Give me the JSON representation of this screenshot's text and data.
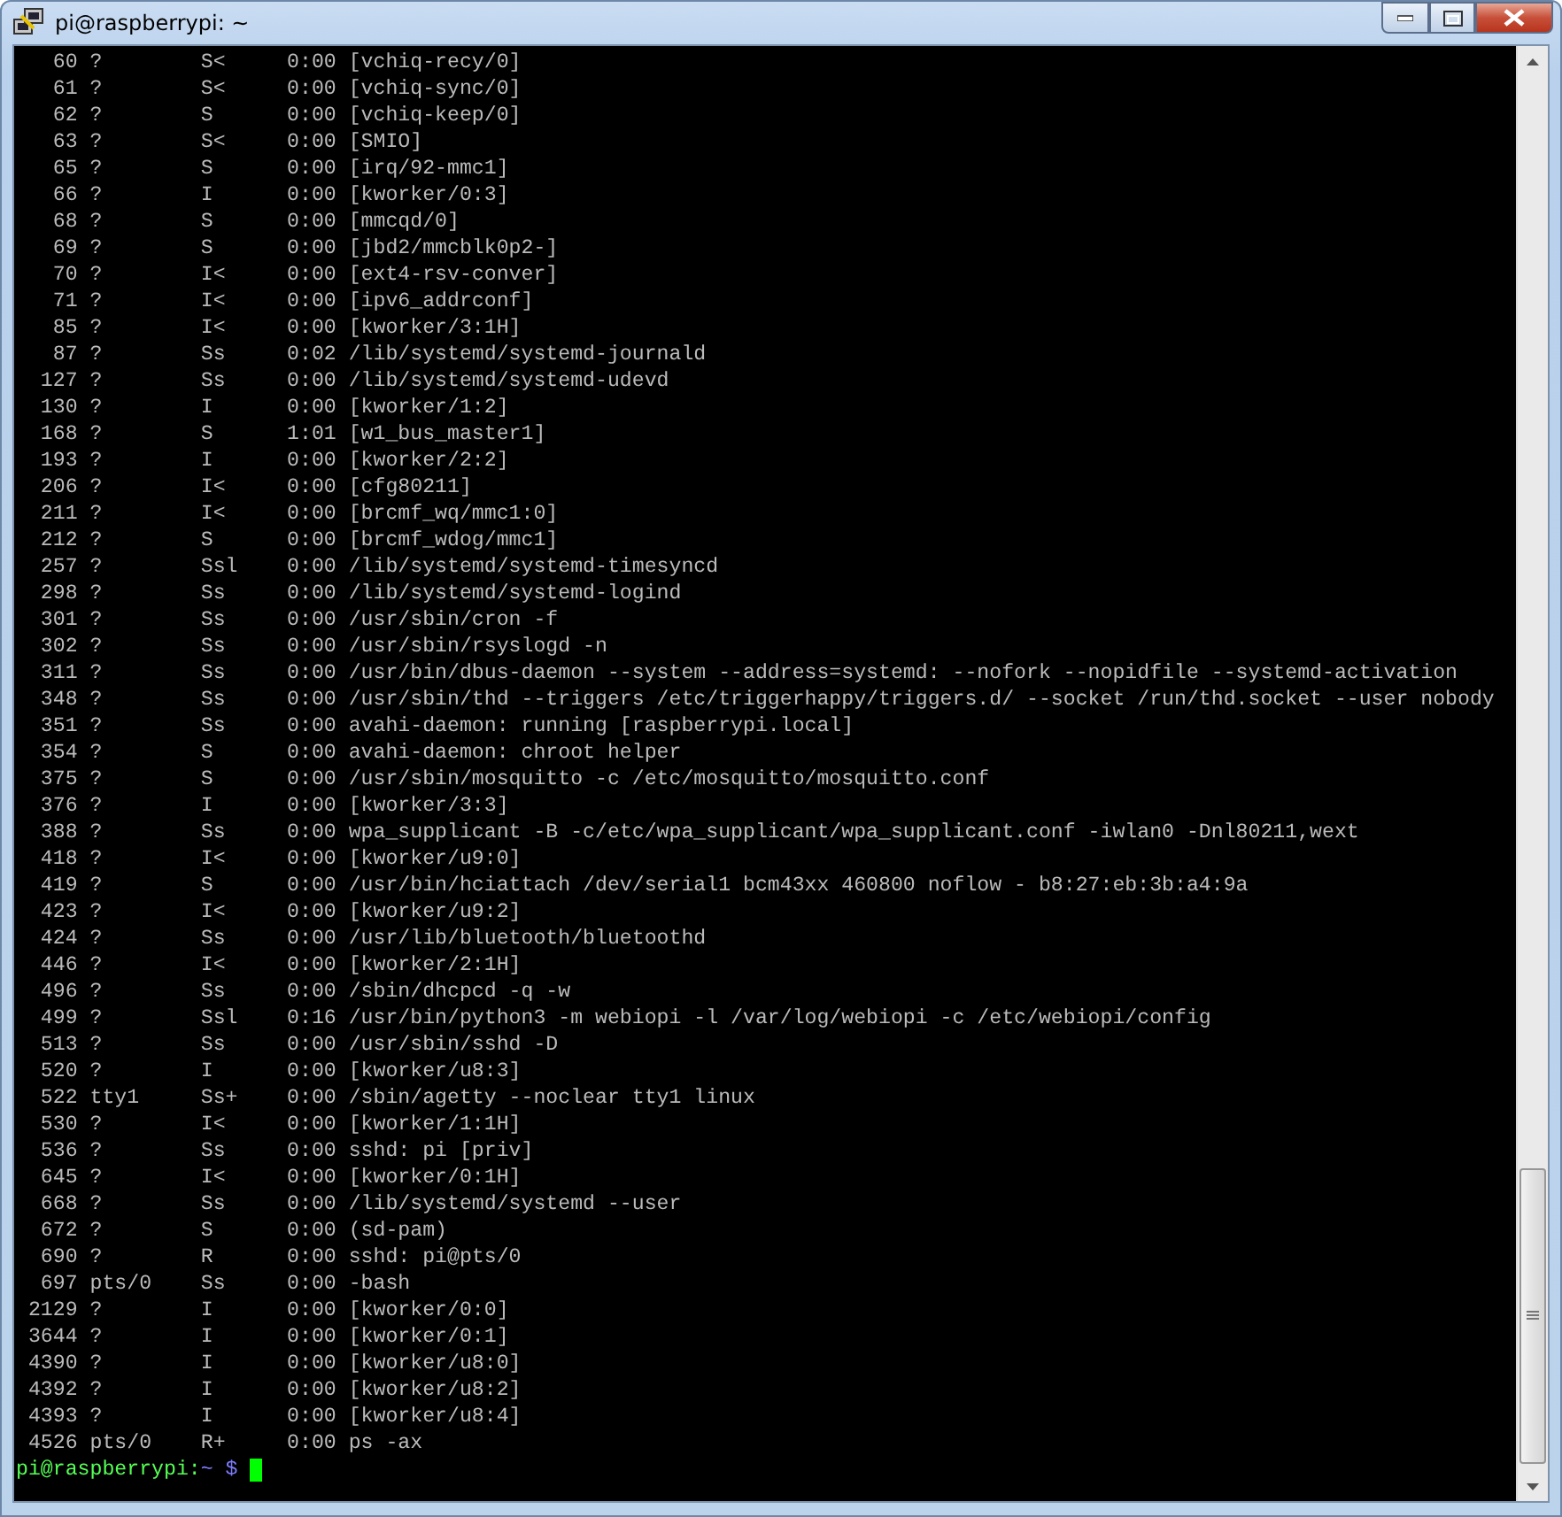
{
  "window": {
    "title": "pi@raspberrypi: ~"
  },
  "terminal": {
    "lines": [
      "   60 ?        S<     0:00 [vchiq-recy/0]",
      "   61 ?        S<     0:00 [vchiq-sync/0]",
      "   62 ?        S      0:00 [vchiq-keep/0]",
      "   63 ?        S<     0:00 [SMIO]",
      "   65 ?        S      0:00 [irq/92-mmc1]",
      "   66 ?        I      0:00 [kworker/0:3]",
      "   68 ?        S      0:00 [mmcqd/0]",
      "   69 ?        S      0:00 [jbd2/mmcblk0p2-]",
      "   70 ?        I<     0:00 [ext4-rsv-conver]",
      "   71 ?        I<     0:00 [ipv6_addrconf]",
      "   85 ?        I<     0:00 [kworker/3:1H]",
      "   87 ?        Ss     0:02 /lib/systemd/systemd-journald",
      "  127 ?        Ss     0:00 /lib/systemd/systemd-udevd",
      "  130 ?        I      0:00 [kworker/1:2]",
      "  168 ?        S      1:01 [w1_bus_master1]",
      "  193 ?        I      0:00 [kworker/2:2]",
      "  206 ?        I<     0:00 [cfg80211]",
      "  211 ?        I<     0:00 [brcmf_wq/mmc1:0]",
      "  212 ?        S      0:00 [brcmf_wdog/mmc1]",
      "  257 ?        Ssl    0:00 /lib/systemd/systemd-timesyncd",
      "  298 ?        Ss     0:00 /lib/systemd/systemd-logind",
      "  301 ?        Ss     0:00 /usr/sbin/cron -f",
      "  302 ?        Ss     0:00 /usr/sbin/rsyslogd -n",
      "  311 ?        Ss     0:00 /usr/bin/dbus-daemon --system --address=systemd: --nofork --nopidfile --systemd-activation",
      "  348 ?        Ss     0:00 /usr/sbin/thd --triggers /etc/triggerhappy/triggers.d/ --socket /run/thd.socket --user nobody",
      "  351 ?        Ss     0:00 avahi-daemon: running [raspberrypi.local]",
      "  354 ?        S      0:00 avahi-daemon: chroot helper",
      "  375 ?        S      0:00 /usr/sbin/mosquitto -c /etc/mosquitto/mosquitto.conf",
      "  376 ?        I      0:00 [kworker/3:3]",
      "  388 ?        Ss     0:00 wpa_supplicant -B -c/etc/wpa_supplicant/wpa_supplicant.conf -iwlan0 -Dnl80211,wext",
      "  418 ?        I<     0:00 [kworker/u9:0]",
      "  419 ?        S      0:00 /usr/bin/hciattach /dev/serial1 bcm43xx 460800 noflow - b8:27:eb:3b:a4:9a",
      "  423 ?        I<     0:00 [kworker/u9:2]",
      "  424 ?        Ss     0:00 /usr/lib/bluetooth/bluetoothd",
      "  446 ?        I<     0:00 [kworker/2:1H]",
      "  496 ?        Ss     0:00 /sbin/dhcpcd -q -w",
      "  499 ?        Ssl    0:16 /usr/bin/python3 -m webiopi -l /var/log/webiopi -c /etc/webiopi/config",
      "  513 ?        Ss     0:00 /usr/sbin/sshd -D",
      "  520 ?        I      0:00 [kworker/u8:3]",
      "  522 tty1     Ss+    0:00 /sbin/agetty --noclear tty1 linux",
      "  530 ?        I<     0:00 [kworker/1:1H]",
      "  536 ?        Ss     0:00 sshd: pi [priv]",
      "  645 ?        I<     0:00 [kworker/0:1H]",
      "  668 ?        Ss     0:00 /lib/systemd/systemd --user",
      "  672 ?        S      0:00 (sd-pam)",
      "  690 ?        R      0:00 sshd: pi@pts/0",
      "  697 pts/0    Ss     0:00 -bash",
      " 2129 ?        I      0:00 [kworker/0:0]",
      " 3644 ?        I      0:00 [kworker/0:1]",
      " 4390 ?        I      0:00 [kworker/u8:0]",
      " 4392 ?        I      0:00 [kworker/u8:2]",
      " 4393 ?        I      0:00 [kworker/u8:4]",
      " 4526 pts/0    R+     0:00 ps -ax"
    ],
    "prompt": {
      "user_host": "pi@raspberrypi:",
      "path": "~",
      "symbol": "$"
    }
  }
}
